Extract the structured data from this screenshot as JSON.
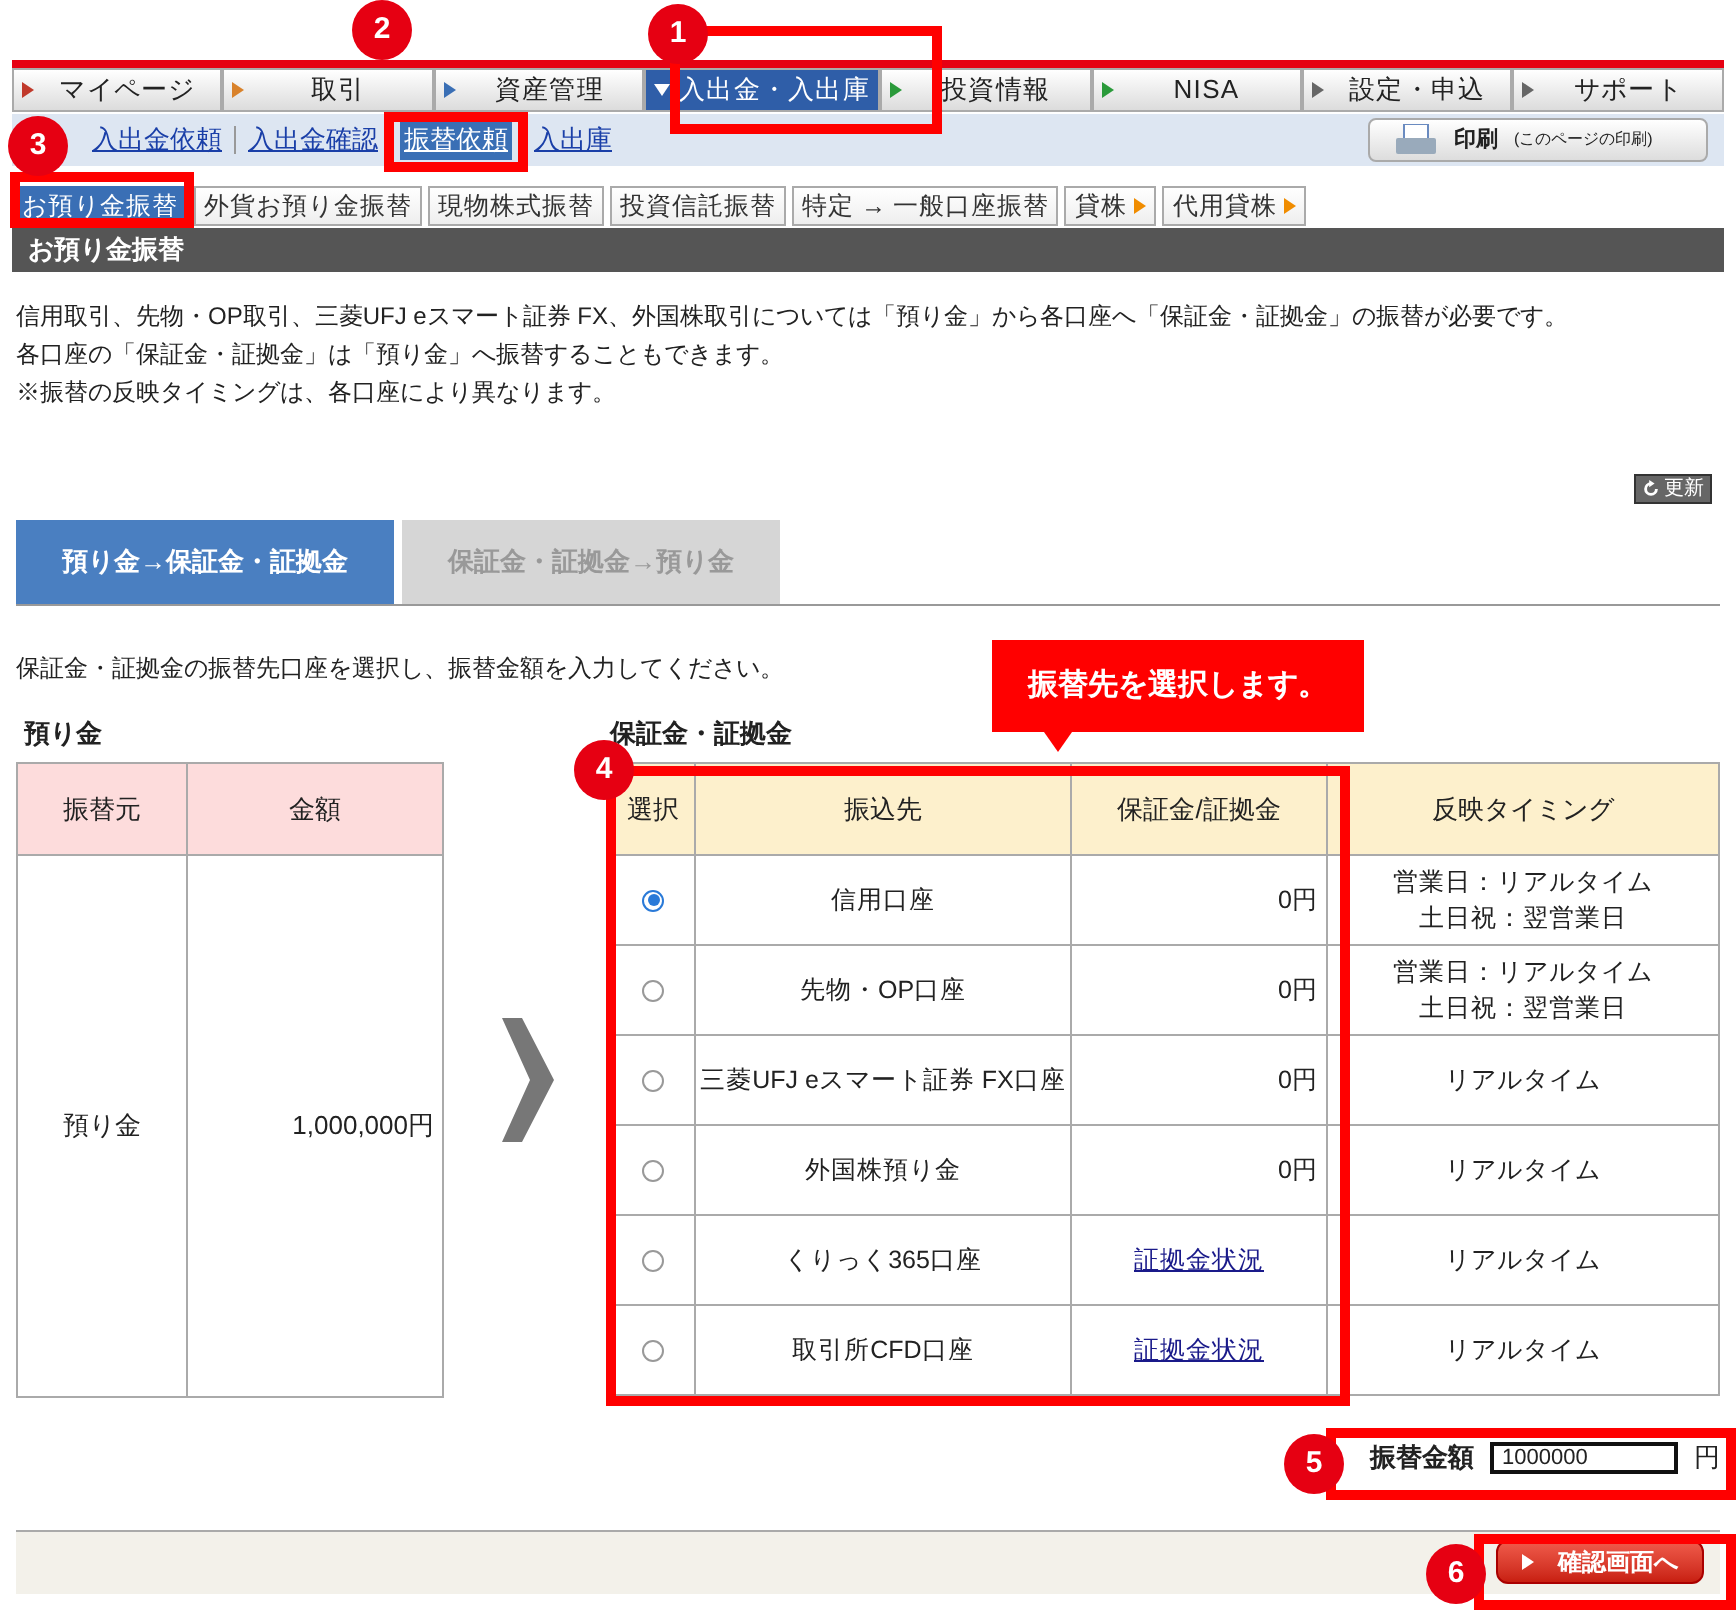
{
  "main_nav": [
    {
      "label": "マイページ",
      "selected": false
    },
    {
      "label": "取引",
      "selected": false
    },
    {
      "label": "資産管理",
      "selected": false
    },
    {
      "label": "入出金・入出庫",
      "selected": true
    },
    {
      "label": "投資情報",
      "selected": false
    },
    {
      "label": "NISA",
      "selected": false
    },
    {
      "label": "設定・申込",
      "selected": false
    },
    {
      "label": "サポート",
      "selected": false
    }
  ],
  "sub_nav": [
    {
      "label": "入出金依頼",
      "selected": false
    },
    {
      "label": "入出金確認",
      "selected": false
    },
    {
      "label": "振替依頼",
      "selected": true
    },
    {
      "label": "入出庫",
      "selected": false
    }
  ],
  "print_button": {
    "label": "印刷",
    "note": "(このページの印刷)"
  },
  "transfer_tabs": [
    {
      "label": "お預り金振替",
      "selected": true,
      "more": false
    },
    {
      "label": "外貨お預り金振替",
      "selected": false,
      "more": false
    },
    {
      "label": "現物株式振替",
      "selected": false,
      "more": false
    },
    {
      "label": "投資信託振替",
      "selected": false,
      "more": false
    },
    {
      "label": "特定 → 一般口座振替",
      "selected": false,
      "more": false
    },
    {
      "label": "貸株",
      "selected": false,
      "more": true
    },
    {
      "label": "代用貸株",
      "selected": false,
      "more": true
    }
  ],
  "section_title": "お預り金振替",
  "description": [
    "信用取引、先物・OP取引、三菱UFJ eスマート証券 FX、外国株取引については「預り金」から各口座へ「保証金・証拠金」の振替が必要です。",
    "各口座の「保証金・証拠金」は「預り金」へ振替することもできます。",
    "※振替の反映タイミングは、各口座により異なります。"
  ],
  "refresh_button": "更新",
  "direction_tabs": [
    {
      "label": "預り金→保証金・証拠金",
      "selected": true
    },
    {
      "label": "保証金・証拠金→預り金",
      "selected": false
    }
  ],
  "instruction": "保証金・証拠金の振替先口座を選択し、振替金額を入力してください。",
  "source": {
    "heading": "預り金",
    "columns": [
      "振替元",
      "金額"
    ],
    "row": [
      "預り金",
      "1,000,000円"
    ]
  },
  "destination": {
    "heading": "保証金・証拠金",
    "columns": [
      "選択",
      "振込先",
      "保証金/証拠金",
      "反映タイミング"
    ],
    "rows": [
      {
        "selected": true,
        "account": "信用口座",
        "amount": "0円",
        "kind": "text",
        "timing": [
          "営業日：リアルタイム",
          "土日祝：翌営業日"
        ]
      },
      {
        "selected": false,
        "account": "先物・OP口座",
        "amount": "0円",
        "kind": "text",
        "timing": [
          "営業日：リアルタイム",
          "土日祝：翌営業日"
        ]
      },
      {
        "selected": false,
        "account": "三菱UFJ eスマート証券 FX口座",
        "amount": "0円",
        "kind": "text",
        "timing": [
          "リアルタイム"
        ]
      },
      {
        "selected": false,
        "account": "外国株預り金",
        "amount": "0円",
        "kind": "text",
        "timing": [
          "リアルタイム"
        ]
      },
      {
        "selected": false,
        "account": "くりっく365口座",
        "amount": "証拠金状況",
        "kind": "link",
        "timing": [
          "リアルタイム"
        ]
      },
      {
        "selected": false,
        "account": "取引所CFD口座",
        "amount": "証拠金状況",
        "kind": "link",
        "timing": [
          "リアルタイム"
        ]
      }
    ]
  },
  "amount_field": {
    "label": "振替金額",
    "value": "1000000",
    "unit": "円"
  },
  "confirm_button": "確認画面へ",
  "annotations": {
    "callout": "振替先を選択します。",
    "markers": [
      "1",
      "2",
      "3",
      "4",
      "5",
      "6"
    ]
  }
}
